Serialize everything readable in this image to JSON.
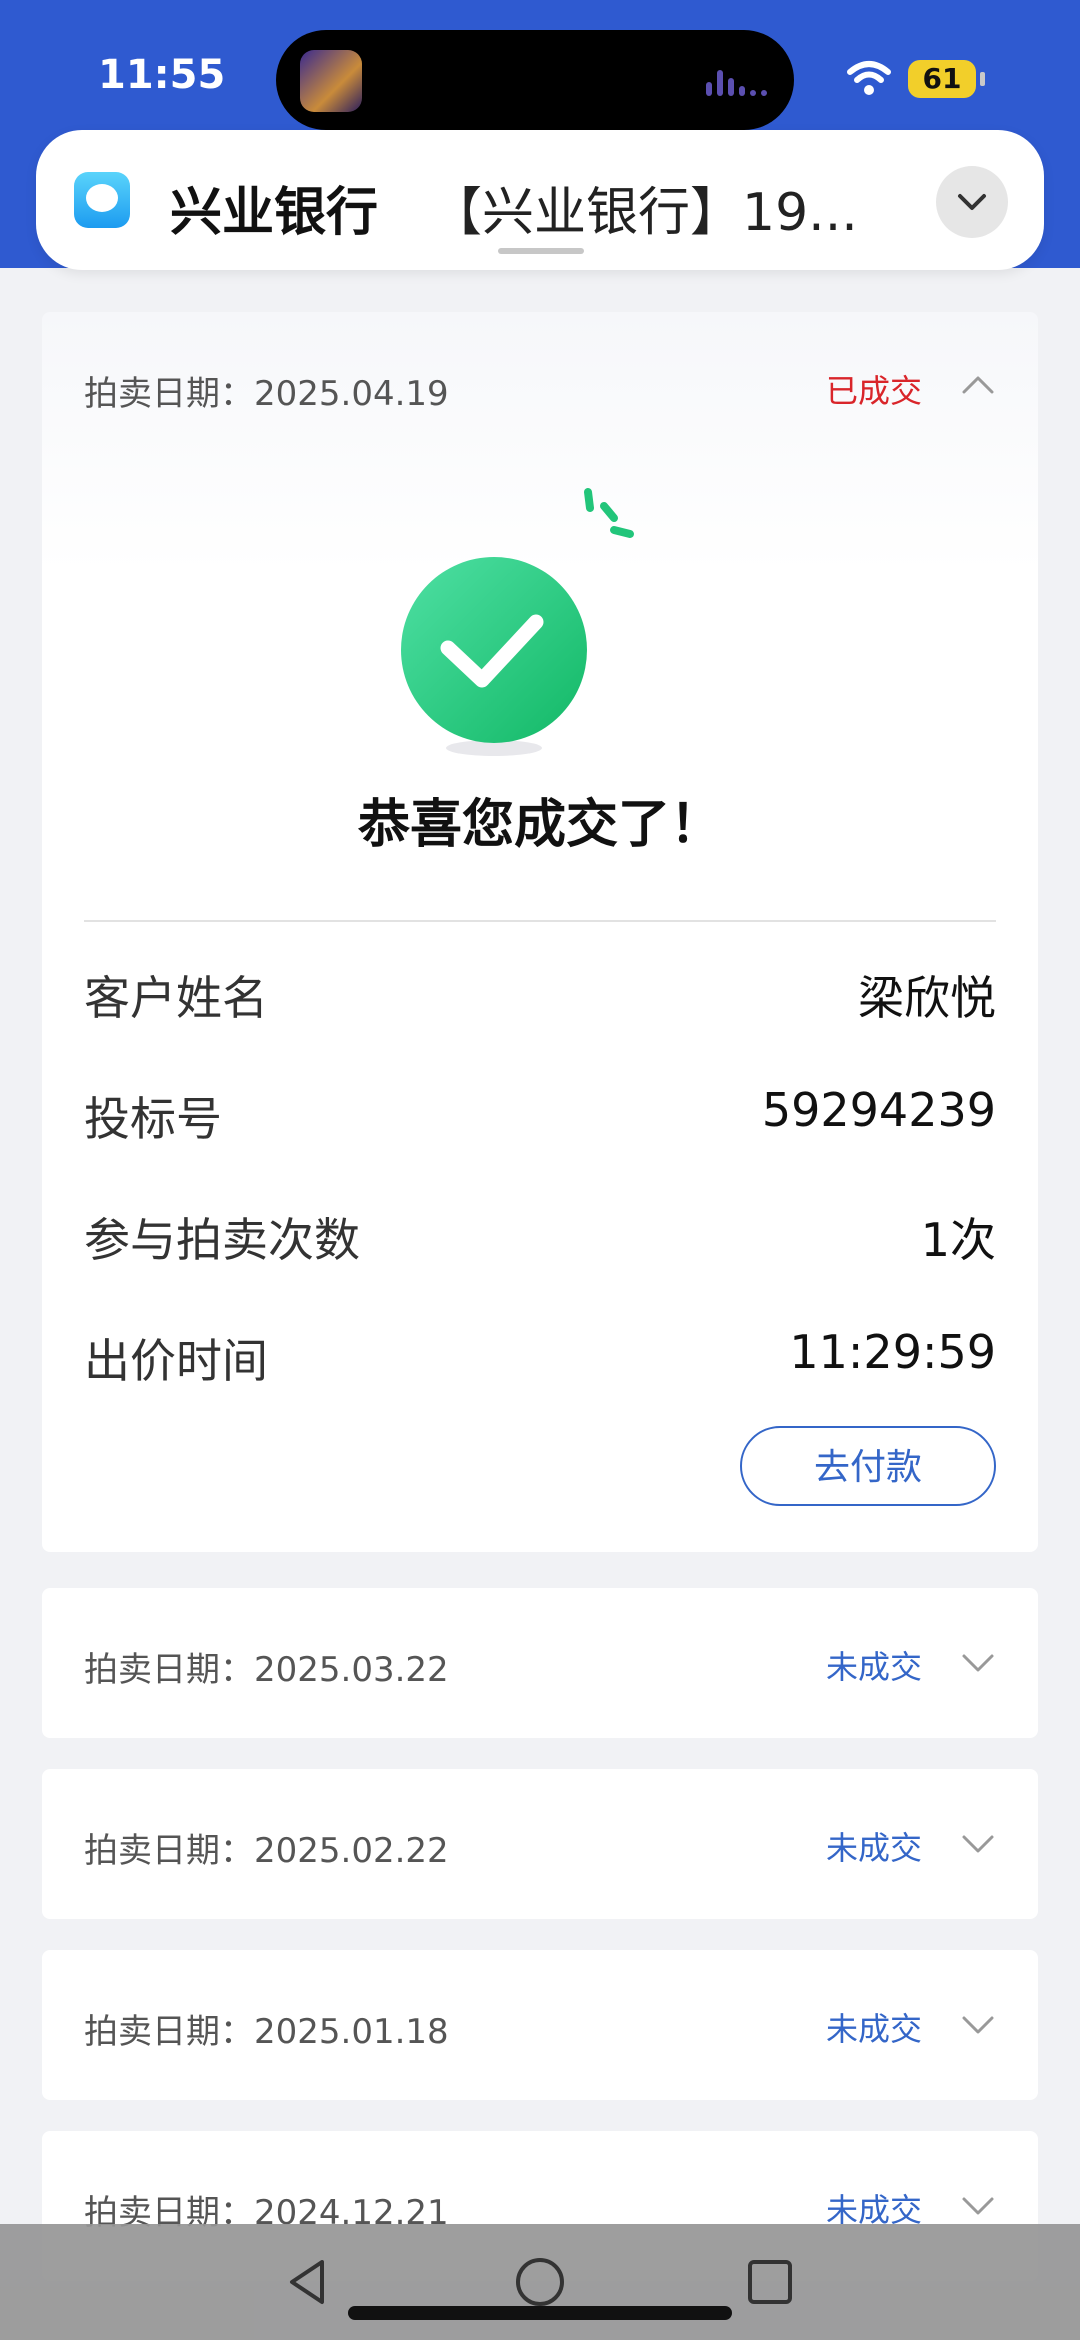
{
  "status_bar": {
    "time": "11:55",
    "battery": "61"
  },
  "notification": {
    "sender": "兴业银行",
    "preview": "【兴业银行】19..."
  },
  "main_card": {
    "date_label": "拍卖日期：2025.04.19",
    "status": "已成交",
    "congrats": "恭喜您成交了！",
    "details": [
      {
        "key": "客户姓名",
        "value": "梁欣悦"
      },
      {
        "key": "投标号",
        "value": "59294239"
      },
      {
        "key": "参与拍卖次数",
        "value": "1次"
      },
      {
        "key": "出价时间",
        "value": "11:29:59"
      }
    ],
    "pay_button": "去付款"
  },
  "auction_list": [
    {
      "date_label": "拍卖日期：2025.03.22",
      "status": "未成交"
    },
    {
      "date_label": "拍卖日期：2025.02.22",
      "status": "未成交"
    },
    {
      "date_label": "拍卖日期：2025.01.18",
      "status": "未成交"
    },
    {
      "date_label": "拍卖日期：2024.12.21",
      "status": "未成交"
    }
  ],
  "colors": {
    "header_blue": "#2f5ad0",
    "done_red": "#d9252a",
    "notdone_blue": "#3466c8",
    "success_green": "#22c57a"
  },
  "icons": [
    "wifi-icon",
    "messages-app-icon",
    "chevron-up-icon",
    "chevron-down-icon",
    "success-check-icon",
    "back-nav-icon",
    "home-nav-icon",
    "recents-nav-icon"
  ]
}
